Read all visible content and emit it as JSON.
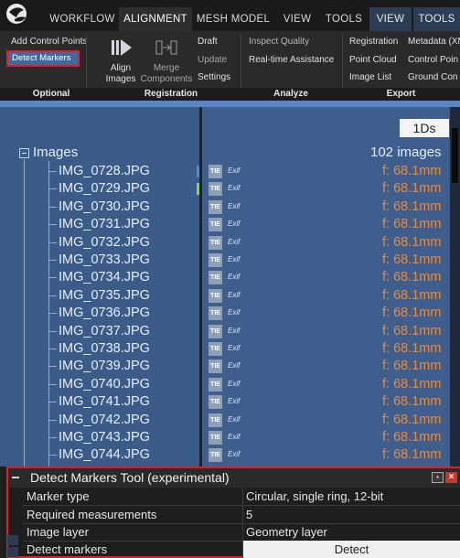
{
  "tabs": [
    "WORKFLOW",
    "ALIGNMENT",
    "MESH MODEL",
    "VIEW",
    "TOOLS",
    "VIEW",
    "TOOLS"
  ],
  "ribbon": {
    "optional": {
      "add_control_points": "Add Control Points",
      "detect_markers": "Detect Markers"
    },
    "registration": {
      "align_images_1": "Align",
      "align_images_2": "Images",
      "merge_components_1": "Merge",
      "merge_components_2": "Components",
      "draft": "Draft",
      "update": "Update",
      "settings": "Settings"
    },
    "analyze": {
      "inspect_quality": "Inspect Quality",
      "realtime_assistance": "Real-time Assistance"
    },
    "export": {
      "registration": "Registration",
      "point_cloud": "Point Cloud",
      "image_list": "Image List",
      "metadata": "Metadata (XM",
      "control_points": "Control Poin",
      "ground_control": "Ground Con"
    },
    "groups": {
      "optional": "Optional",
      "registration": "Registration",
      "analyze": "Analyze",
      "export": "Export"
    }
  },
  "tree": {
    "button_1ds": "1Ds",
    "root_label": "Images",
    "root_count": "102 images",
    "tic_label": "TIE",
    "exif_label": "Exif",
    "rows": [
      {
        "name": "IMG_0728.JPG",
        "focal": "f: 68.1mm",
        "marker": "#4a8ad8"
      },
      {
        "name": "IMG_0729.JPG",
        "focal": "f: 68.1mm",
        "marker": "#8cd83a"
      },
      {
        "name": "IMG_0730.JPG",
        "focal": "f: 68.1mm",
        "marker": ""
      },
      {
        "name": "IMG_0731.JPG",
        "focal": "f: 68.1mm",
        "marker": ""
      },
      {
        "name": "IMG_0732.JPG",
        "focal": "f: 68.1mm",
        "marker": ""
      },
      {
        "name": "IMG_0733.JPG",
        "focal": "f: 68.1mm",
        "marker": ""
      },
      {
        "name": "IMG_0734.JPG",
        "focal": "f: 68.1mm",
        "marker": ""
      },
      {
        "name": "IMG_0735.JPG",
        "focal": "f: 68.1mm",
        "marker": ""
      },
      {
        "name": "IMG_0736.JPG",
        "focal": "f: 68.1mm",
        "marker": ""
      },
      {
        "name": "IMG_0737.JPG",
        "focal": "f: 68.1mm",
        "marker": ""
      },
      {
        "name": "IMG_0738.JPG",
        "focal": "f: 68.1mm",
        "marker": ""
      },
      {
        "name": "IMG_0739.JPG",
        "focal": "f: 68.1mm",
        "marker": ""
      },
      {
        "name": "IMG_0740.JPG",
        "focal": "f: 68.1mm",
        "marker": ""
      },
      {
        "name": "IMG_0741.JPG",
        "focal": "f: 68.1mm",
        "marker": ""
      },
      {
        "name": "IMG_0742.JPG",
        "focal": "f: 68.1mm",
        "marker": ""
      },
      {
        "name": "IMG_0743.JPG",
        "focal": "f: 68.1mm",
        "marker": ""
      },
      {
        "name": "IMG_0744.JPG",
        "focal": "f: 68.1mm",
        "marker": ""
      }
    ]
  },
  "tool": {
    "title": "Detect Markers Tool (experimental)",
    "properties": [
      {
        "key": "Marker type",
        "value": "Circular, single ring, 12-bit"
      },
      {
        "key": "Required measurements",
        "value": "5"
      },
      {
        "key": "Image layer",
        "value": "Geometry layer"
      },
      {
        "key": "Detect markers",
        "value": ""
      }
    ],
    "detect_button": "Detect"
  },
  "colors": {
    "tree_bg": "#3e5f8d",
    "focal": "#e88a3c",
    "highlight": "#e01c2a",
    "selected": "#3d6aa0"
  }
}
